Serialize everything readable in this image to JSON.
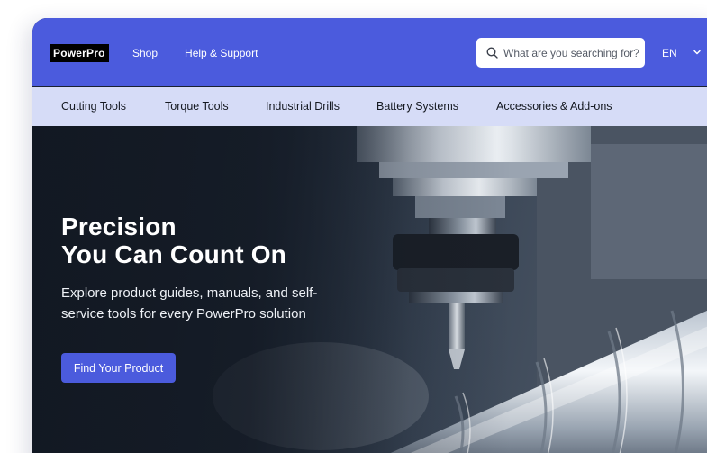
{
  "header": {
    "logo": "PowerPro",
    "nav": [
      {
        "label": "Shop"
      },
      {
        "label": "Help & Support"
      }
    ],
    "search": {
      "placeholder": "What are you searching for?",
      "icon": "search-icon"
    },
    "language": {
      "value": "EN",
      "icon": "chevron-down-icon"
    }
  },
  "categories": [
    {
      "label": "Cutting Tools"
    },
    {
      "label": "Torque Tools"
    },
    {
      "label": "Industrial Drills"
    },
    {
      "label": "Battery Systems"
    },
    {
      "label": "Accessories & Add-ons"
    }
  ],
  "hero": {
    "title_line1": "Precision",
    "title_line2": "You Can Count On",
    "subtitle_line1": "Explore product guides, manuals, and self-",
    "subtitle_line2": "service tools for every PowerPro solution",
    "cta_label": "Find Your Product"
  },
  "colors": {
    "brand": "#4b5bdd",
    "category_bar": "#d6dcf7",
    "logo_bg": "#000000"
  }
}
